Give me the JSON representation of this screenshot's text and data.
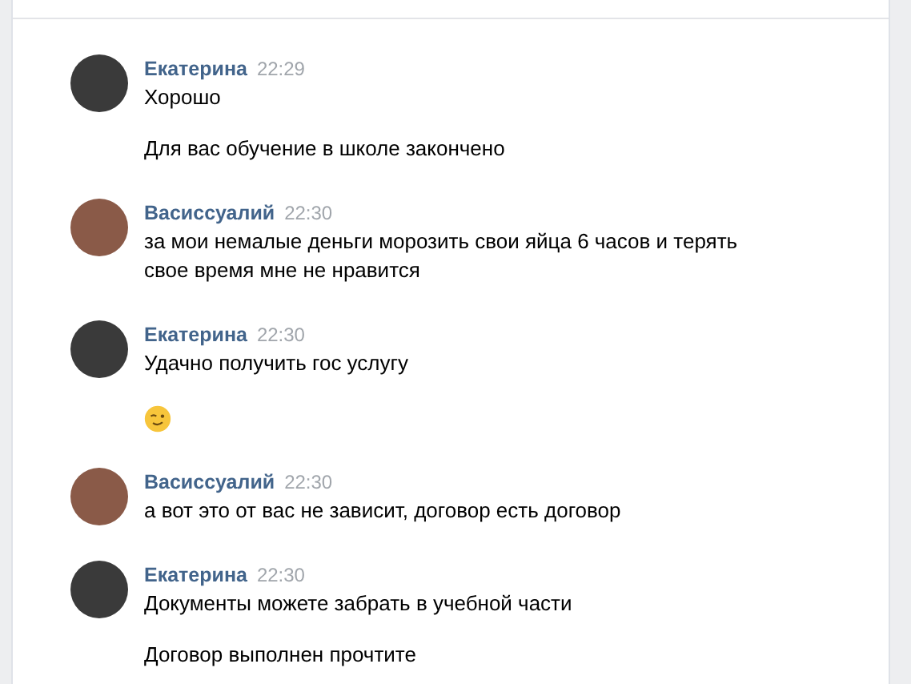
{
  "messages": [
    {
      "author": "Екатерина",
      "time": "22:29",
      "color": "#3a3a3a",
      "lines": [
        {
          "kind": "text",
          "text": "Хорошо"
        },
        {
          "kind": "text",
          "text": "Для вас обучение в школе закончено"
        }
      ]
    },
    {
      "author": "Васиссуалий",
      "time": "22:30",
      "color": "#8a5a48",
      "lines": [
        {
          "kind": "text",
          "text": "за мои немалые деньги морозить свои яйца 6 часов и терять свое время мне не нравится"
        }
      ]
    },
    {
      "author": "Екатерина",
      "time": "22:30",
      "color": "#3a3a3a",
      "lines": [
        {
          "kind": "text",
          "text": "Удачно получить гос услугу"
        },
        {
          "kind": "emoji"
        }
      ]
    },
    {
      "author": "Васиссуалий",
      "time": "22:30",
      "color": "#8a5a48",
      "lines": [
        {
          "kind": "text",
          "text": "а вот это от вас не зависит, договор есть договор"
        }
      ]
    },
    {
      "author": "Екатерина",
      "time": "22:30",
      "color": "#3a3a3a",
      "lines": [
        {
          "kind": "text",
          "text": "Документы можете забрать в учебной части"
        },
        {
          "kind": "text",
          "text": "Договор выполнен прочтите"
        }
      ]
    }
  ]
}
